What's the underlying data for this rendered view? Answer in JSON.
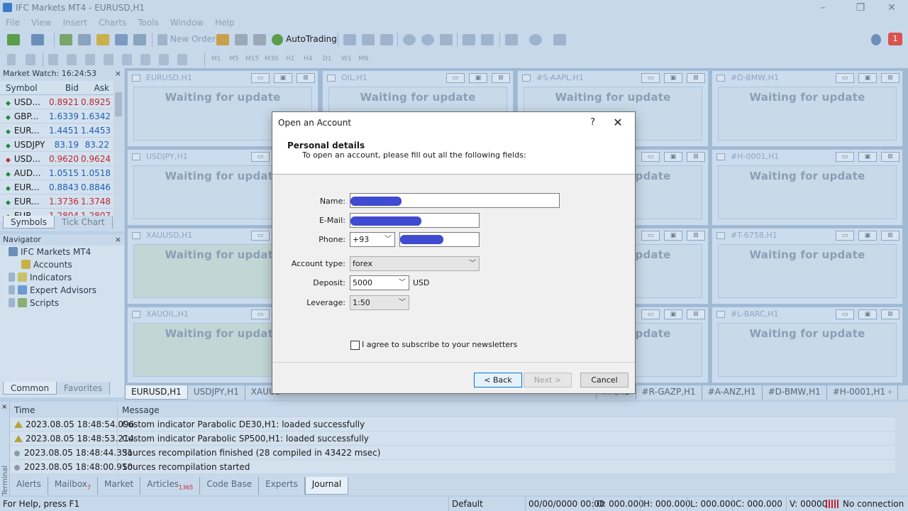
{
  "window": {
    "title": "IFC Markets MT4 - EURUSD,H1",
    "minimize": "–",
    "restore": "❐",
    "close": "✕"
  },
  "menu": [
    "File",
    "View",
    "Insert",
    "Charts",
    "Tools",
    "Window",
    "Help"
  ],
  "toolbar": {
    "new_order": "New Order",
    "autotrading": "AutoTrading",
    "notification_count": "1",
    "timeframes": [
      "M1",
      "M5",
      "M15",
      "M30",
      "H1",
      "H4",
      "D1",
      "W1",
      "MN"
    ]
  },
  "market_watch": {
    "title": "Market Watch: 16:24:53",
    "close": "×",
    "columns": [
      "Symbol",
      "Bid",
      "Ask"
    ],
    "rows": [
      {
        "symbol": "USD...",
        "bid": "0.8921",
        "ask": "0.8925",
        "dir": "up",
        "color": "dn"
      },
      {
        "symbol": "GBP...",
        "bid": "1.6339",
        "ask": "1.6342",
        "dir": "up",
        "color": "up"
      },
      {
        "symbol": "EUR...",
        "bid": "1.4451",
        "ask": "1.4453",
        "dir": "up",
        "color": "up"
      },
      {
        "symbol": "USDJPY",
        "bid": "83.19",
        "ask": "83.22",
        "dir": "up",
        "color": "up"
      },
      {
        "symbol": "USD...",
        "bid": "0.9620",
        "ask": "0.9624",
        "dir": "dn",
        "color": "dn"
      },
      {
        "symbol": "AUD...",
        "bid": "1.0515",
        "ask": "1.0518",
        "dir": "up",
        "color": "up"
      },
      {
        "symbol": "EUR...",
        "bid": "0.8843",
        "ask": "0.8846",
        "dir": "up",
        "color": "up"
      },
      {
        "symbol": "EUR...",
        "bid": "1.3736",
        "ask": "1.3748",
        "dir": "up",
        "color": "dn"
      },
      {
        "symbol": "EUR",
        "bid": "1.2804",
        "ask": "1.2807",
        "dir": "up",
        "color": "dn"
      }
    ],
    "tabs": [
      "Symbols",
      "Tick Chart"
    ]
  },
  "navigator": {
    "title": "Navigator",
    "close": "×",
    "root": "IFC Markets MT4",
    "items": [
      "Accounts",
      "Indicators",
      "Expert Advisors",
      "Scripts"
    ],
    "tabs": [
      "Common",
      "Favorites"
    ]
  },
  "charts": {
    "waiting_text": "Waiting for update",
    "windows": [
      {
        "title": "EURUSD,H1"
      },
      {
        "title": "OIL,H1"
      },
      {
        "title": "#S-AAPL,H1"
      },
      {
        "title": "#D-BMW,H1"
      },
      {
        "title": "USDJPY,H1"
      },
      {
        "title": ""
      },
      {
        "title": ""
      },
      {
        "title": "#H-0001,H1"
      },
      {
        "title": "XAUUSD,H1"
      },
      {
        "title": ""
      },
      {
        "title": ""
      },
      {
        "title": "#T-6758,H1"
      },
      {
        "title": "XAUOIL,H1"
      },
      {
        "title": ""
      },
      {
        "title": ""
      },
      {
        "title": "#L-BARC,H1"
      }
    ],
    "tabs": [
      "EURUSD,H1",
      "USDJPY,H1",
      "XAUUS",
      "#A,H1",
      "#R-GAZP,H1",
      "#A-ANZ,H1",
      "#D-BMW,H1",
      "#H-0001,H1 ‹"
    ]
  },
  "terminal": {
    "side_label": "Terminal",
    "columns": [
      "Time",
      "Message"
    ],
    "rows": [
      {
        "icon": "warn",
        "time": "2023.08.05 18:48:54.096",
        "message": "Custom indicator Parabolic DE30,H1: loaded successfully"
      },
      {
        "icon": "warn",
        "time": "2023.08.05 18:48:53.214",
        "message": "Custom indicator Parabolic SP500,H1: loaded successfully"
      },
      {
        "icon": "info",
        "time": "2023.08.05 18:48:44.331",
        "message": "Sources recompilation finished (28 compiled in 43422 msec)"
      },
      {
        "icon": "info",
        "time": "2023.08.05 18:48:00.910",
        "message": "Sources recompilation started"
      }
    ],
    "tabs": [
      {
        "label": "Alerts",
        "badge": ""
      },
      {
        "label": "Mailbox",
        "badge": "7"
      },
      {
        "label": "Market",
        "badge": ""
      },
      {
        "label": "Articles",
        "badge": "1365"
      },
      {
        "label": "Code Base",
        "badge": ""
      },
      {
        "label": "Experts",
        "badge": ""
      },
      {
        "label": "Journal",
        "badge": ""
      }
    ]
  },
  "status": {
    "help": "For Help, press F1",
    "profile": "Default",
    "datetime": "00/00/0000 00:00",
    "open": "O: 000.000",
    "high": "H: 000.000",
    "low": "L: 000.000",
    "close": "C: 000.000",
    "volume": "V: 00000",
    "connection": "No connection"
  },
  "dialog": {
    "title": "Open an Account",
    "help": "?",
    "close": "✕",
    "heading": "Personal details",
    "subheading": "To open an account, please fill out all the following fields:",
    "labels": {
      "name": "Name:",
      "email": "E-Mail:",
      "phone": "Phone:",
      "account_type": "Account type:",
      "deposit": "Deposit:",
      "leverage": "Leverage:"
    },
    "phone_code": "+93",
    "account_type": "forex",
    "deposit": "5000",
    "currency": "USD",
    "leverage": "1:50",
    "newsletter": "I agree to subscribe to your newsletters",
    "back": "< Back",
    "next": "Next >",
    "cancel": "Cancel"
  }
}
